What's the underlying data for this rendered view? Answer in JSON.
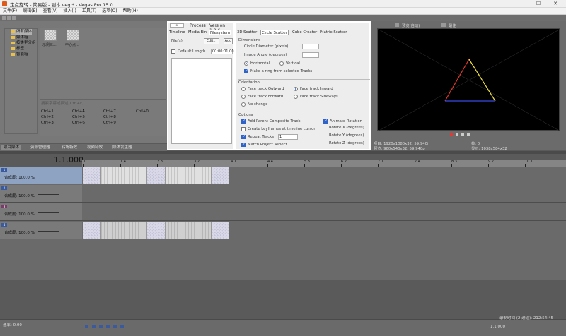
{
  "window": {
    "title": "定点旋转 - 简易版 - 副本.veg * - Vegas Pro 15.0",
    "minimize": "—",
    "maximize": "☐",
    "close": "✕"
  },
  "menu": [
    "文件(F)",
    "编辑(E)",
    "查看(V)",
    "插入(I)",
    "工具(T)",
    "选项(O)",
    "帮助(H)"
  ],
  "explorer": {
    "tree": [
      "所有媒体",
      "媒体箱",
      "按类型分组",
      "标签",
      "智能箱"
    ],
    "thumbs": [
      {
        "label": "示例三..."
      },
      {
        "label": "中心点..."
      }
    ],
    "search_placeholder": "搜索字幕或描述(Ctrl+F)",
    "shortcuts": [
      "Ctrl+1",
      "Ctrl+2",
      "Ctrl+3",
      "Ctrl+4",
      "Ctrl+5",
      "Ctrl+6",
      "Ctrl+7",
      "Ctrl+8",
      "Ctrl+9",
      "Ctrl+0"
    ]
  },
  "left_tabs": [
    "项目媒体",
    "资源管理器",
    "转场特效",
    "视频特效",
    "媒体发生器"
  ],
  "process": {
    "title": "Process",
    "version": "Version 1.0.6",
    "tabs": [
      "Timeline",
      "Media Bin",
      "Filesystem"
    ],
    "filesize_label": "File(s):",
    "edit_button": "Edit...",
    "add_button": "Add",
    "default_length_label": "Default Length",
    "default_length_value": "00:00:01;00"
  },
  "scatter": {
    "tabs": [
      "3D Scatter",
      "Circle Scatter",
      "Cube Creator",
      "Matrix Scatter"
    ],
    "active_tab": "Circle Scatter",
    "dimensions_title": "Dimensions",
    "circle_diameter_label": "Circle Diameter (pixels)",
    "circle_diameter_value": "",
    "image_angle_label": "Image Angle (degrees)",
    "image_angle_value": "",
    "horizontal_label": "Horizontal",
    "vertical_label": "Vertical",
    "make_ring_label": "Make a ring from selected Tracks",
    "orientation_title": "Orientation",
    "face_outward": "Face track Outward",
    "face_inward": "Face track Inward",
    "face_forward": "Face track Forward",
    "face_sideways": "Face track Sideways",
    "no_change": "No change",
    "options_title": "Options",
    "add_parent": "Add Parent Composite Track",
    "animate_rotation": "Animate Rotation",
    "create_keyframes": "Create keyframes at timeline cursor",
    "repeat_tracks": "Repeat Tracks",
    "repeat_value": "1",
    "rotate_x": "Rotate X (degrees)",
    "rotate_y": "Rotate Y (degrees)",
    "rotate_z": "Rotate Z (degrees)",
    "match_aspect": "Match Project Aspect"
  },
  "preview": {
    "mode": "预览(自动)",
    "quality": "最佳",
    "info_project_label": "项目:",
    "info_project_value": "1920x1080x32, 59.940i",
    "info_preview_label": "预览:",
    "info_preview_value": "960x540x32, 59.940p",
    "info_frame_label": "帧:",
    "info_frame_value": "0",
    "info_display_label": "显示:",
    "info_display_value": "1038x584x32"
  },
  "timeline": {
    "timecode": "1.1.000",
    "ruler": [
      "1.1",
      "1.4",
      "2.3",
      "3.2",
      "4.1",
      "4.4",
      "5.3",
      "6.2",
      "7.1",
      "7.4",
      "8.3",
      "9.2",
      "10.1"
    ],
    "tracks": [
      {
        "label": "合成度:",
        "value": "100.0 %",
        "number": "1"
      },
      {
        "label": "合成度:",
        "value": "100.0 %",
        "number": "2"
      },
      {
        "label": "合成度:",
        "value": "100.0 %",
        "number": "3"
      },
      {
        "label": "合成度:",
        "value": "100.0 %",
        "number": "4"
      }
    ]
  },
  "status": {
    "rate": "速率: 0.00",
    "position": "1.1.000",
    "record_time": "录制时间 (2 通道): 212:54:45"
  }
}
